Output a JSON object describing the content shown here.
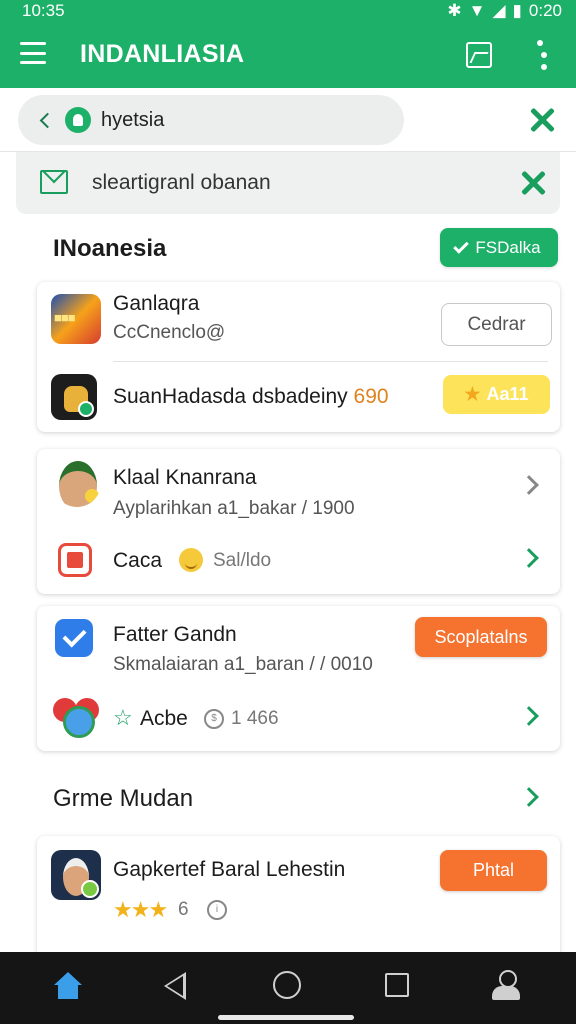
{
  "status_bar": {
    "time": "10:35",
    "battery": "0:20"
  },
  "app_bar": {
    "title": "INDANLIASIA"
  },
  "search": {
    "text": "hyetsia"
  },
  "secondary": {
    "text": "sleartigranl obanan"
  },
  "section1": {
    "title": "INoanesia",
    "action_label": "FSDalka",
    "items": [
      {
        "title": "Ganlaqra",
        "subtitle": "CcCnenclo@",
        "button": "Cedrar"
      },
      {
        "title": "SuanHadasda dsbadeiny",
        "number": "690",
        "button": "Aa11"
      }
    ]
  },
  "card2": {
    "item1": {
      "title": "Klaal Knanrana",
      "subtitle": "Ayplarihkan a1_bakar / 1900"
    },
    "item2": {
      "title": "Caca",
      "extra": "Sal/ldo"
    }
  },
  "card3": {
    "item1": {
      "title": "Fatter Gandn",
      "subtitle": "Skmalaiaran a1_baran / / 0010",
      "button": "Scoplatalns"
    },
    "item2": {
      "title": "Acbe",
      "extra": "1 466"
    }
  },
  "section2": {
    "title": "Grme Mudan"
  },
  "card4": {
    "item1": {
      "title": "Gapkertef Baral Lehestin",
      "button": "Phtal",
      "stars": "★★★",
      "extra": "6"
    }
  },
  "colors": {
    "primary": "#1db069",
    "orange": "#f5722f",
    "yellow": "#fde35a"
  }
}
